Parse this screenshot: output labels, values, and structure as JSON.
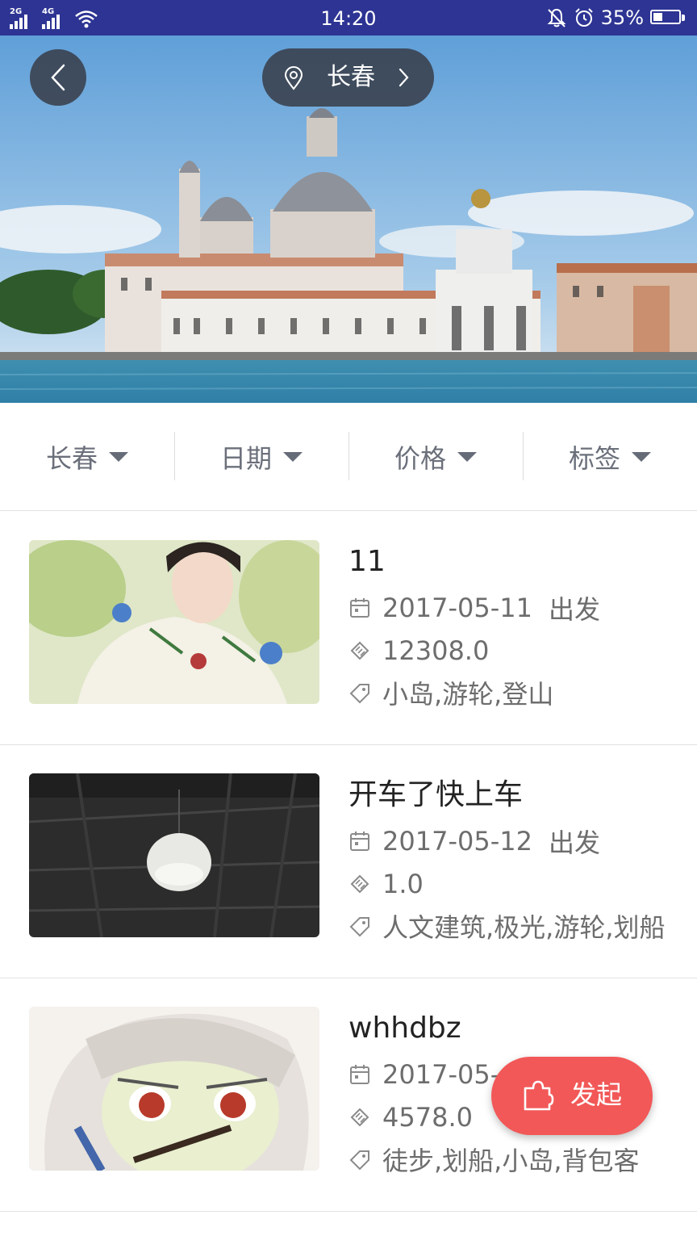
{
  "status_bar": {
    "network_1": "2G",
    "network_2": "4G",
    "time": "14:20",
    "battery": "35%",
    "battery_level": 0.35
  },
  "header": {
    "location": "长春"
  },
  "filters": [
    {
      "label": "长春"
    },
    {
      "label": "日期"
    },
    {
      "label": "价格"
    },
    {
      "label": "标签"
    }
  ],
  "trips": [
    {
      "title": "11",
      "date": "2017-05-11",
      "depart_label": "出发",
      "price": "12308.0",
      "tags": "小岛,游轮,登山"
    },
    {
      "title": "开车了快上车",
      "date": "2017-05-12",
      "depart_label": "出发",
      "price": "1.0",
      "tags": "人文建筑,极光,游轮,划船"
    },
    {
      "title": "whhdbz",
      "date": "2017-05-",
      "depart_label": "",
      "price": "4578.0",
      "tags": "徒步,划船,小岛,背包客"
    }
  ],
  "fab": {
    "label": "发起"
  },
  "colors": {
    "status_bar": "#2d3493",
    "fab": "#f25858",
    "text_secondary": "#6d6d6d"
  }
}
